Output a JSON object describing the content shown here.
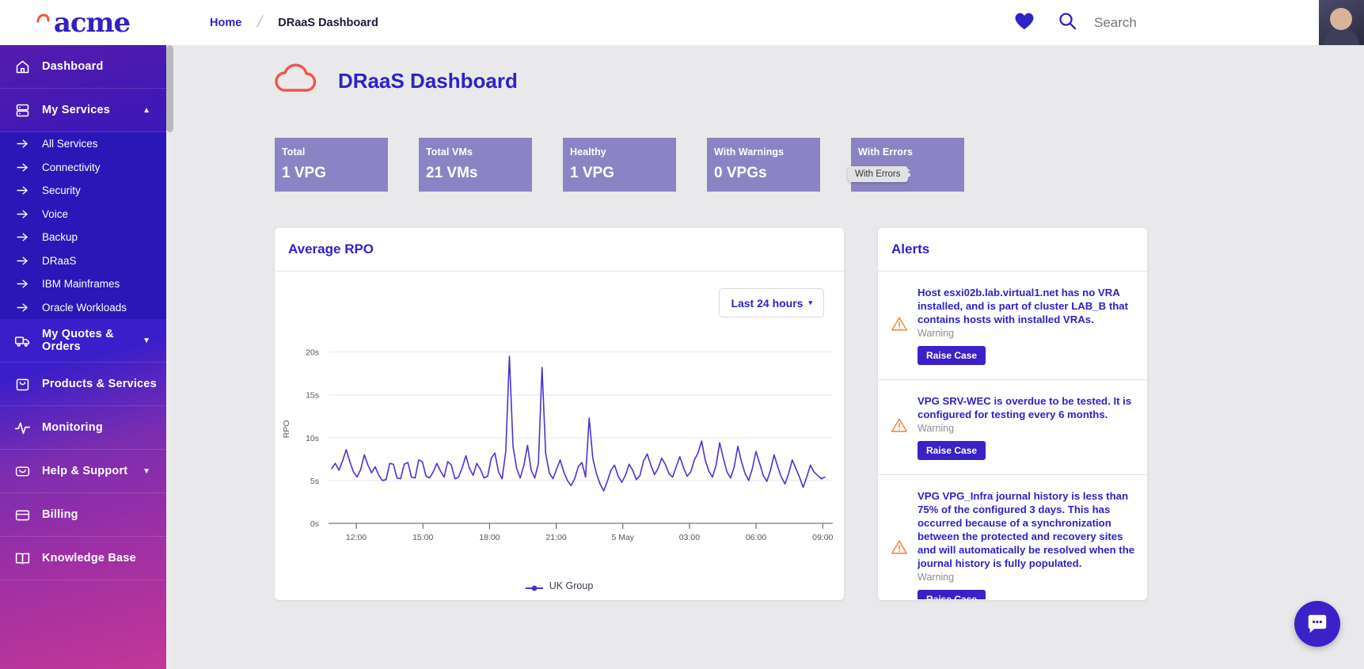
{
  "brand": {
    "name": "acme",
    "logo_icon": "acme-swoosh-icon"
  },
  "topbar": {
    "breadcrumb": {
      "home": "Home",
      "current": "DRaaS Dashboard"
    },
    "favorites_icon": "heart-icon",
    "search": {
      "icon": "search-icon",
      "placeholder": "Search",
      "value": ""
    },
    "avatar_icon": "user-avatar"
  },
  "sidebar": {
    "items": [
      {
        "label": "Dashboard",
        "icon": "home-icon",
        "active": true,
        "caret": ""
      },
      {
        "label": "My Services",
        "icon": "server-icon",
        "active": false,
        "caret": "▲"
      },
      {
        "label": "My Quotes & Orders",
        "icon": "truck-icon",
        "active": false,
        "caret": "▼"
      },
      {
        "label": "Products & Services",
        "icon": "bag-icon",
        "active": false,
        "caret": ""
      },
      {
        "label": "Monitoring",
        "icon": "pulse-icon",
        "active": false,
        "caret": ""
      },
      {
        "label": "Help & Support",
        "icon": "inbox-icon",
        "active": false,
        "caret": "▼"
      },
      {
        "label": "Billing",
        "icon": "card-icon",
        "active": false,
        "caret": ""
      },
      {
        "label": "Knowledge Base",
        "icon": "book-icon",
        "active": false,
        "caret": ""
      }
    ],
    "subitems": [
      {
        "label": "All Services",
        "icon": "arrow-right-icon"
      },
      {
        "label": "Connectivity",
        "icon": "arrow-right-icon"
      },
      {
        "label": "Security",
        "icon": "arrow-right-icon"
      },
      {
        "label": "Voice",
        "icon": "arrow-right-icon"
      },
      {
        "label": "Backup",
        "icon": "arrow-right-icon"
      },
      {
        "label": "DRaaS",
        "icon": "arrow-right-icon"
      },
      {
        "label": "IBM Mainframes",
        "icon": "arrow-right-icon"
      },
      {
        "label": "Oracle Workloads",
        "icon": "arrow-right-icon"
      }
    ]
  },
  "page": {
    "title": "DRaaS Dashboard",
    "icon": "cloud-icon"
  },
  "stats": [
    {
      "label": "Total",
      "value": "1 VPG"
    },
    {
      "label": "Total VMs",
      "value": "21 VMs"
    },
    {
      "label": "Healthy",
      "value": "1 VPG"
    },
    {
      "label": "With Warnings",
      "value": "0 VPGs"
    },
    {
      "label": "With Errors",
      "value": "0 VPGs",
      "tooltip": "With Errors"
    }
  ],
  "chart_panel": {
    "title": "Average RPO",
    "range_button": {
      "label": "Last 24 hours",
      "caret": "▾"
    },
    "legend": {
      "label": "UK Group",
      "color": "#4b32d6"
    }
  },
  "chart_data": {
    "type": "line",
    "title": "Average RPO",
    "xlabel": "",
    "ylabel": "RPO",
    "ylim": [
      0,
      22
    ],
    "yticks": [
      "0s",
      "5s",
      "10s",
      "15s",
      "20s"
    ],
    "ytick_values": [
      0,
      5,
      10,
      15,
      20
    ],
    "xticks": [
      "12:00",
      "15:00",
      "18:00",
      "21:00",
      "5 May",
      "03:00",
      "06:00",
      "09:00"
    ],
    "grid": true,
    "legend_position": "bottom",
    "series": [
      {
        "name": "UK Group",
        "color": "#4b32d6",
        "values": [
          6.4,
          7.0,
          6.2,
          7.3,
          8.6,
          7.2,
          6.0,
          5.4,
          6.3,
          8.0,
          6.8,
          5.9,
          6.6,
          5.6,
          5.0,
          5.1,
          7.0,
          6.9,
          5.3,
          5.2,
          6.9,
          7.1,
          5.4,
          5.3,
          7.4,
          7.2,
          5.5,
          5.3,
          6.0,
          7.0,
          6.1,
          5.4,
          7.2,
          6.8,
          5.2,
          5.4,
          6.5,
          7.9,
          6.4,
          5.6,
          7.0,
          6.3,
          5.3,
          5.5,
          7.6,
          8.2,
          6.0,
          5.2,
          8.4,
          19.5,
          9.0,
          6.4,
          5.3,
          6.8,
          9.1,
          6.2,
          5.3,
          7.0,
          18.2,
          8.2,
          5.9,
          5.2,
          6.3,
          7.4,
          6.0,
          5.0,
          4.4,
          5.2,
          6.6,
          7.1,
          5.4,
          12.3,
          7.6,
          5.8,
          4.6,
          3.8,
          4.9,
          6.2,
          6.8,
          5.5,
          4.8,
          5.6,
          6.9,
          6.2,
          5.1,
          5.6,
          7.3,
          8.1,
          6.8,
          5.7,
          6.4,
          7.6,
          6.9,
          5.8,
          5.4,
          6.6,
          7.8,
          6.5,
          5.5,
          6.0,
          7.4,
          8.2,
          9.6,
          7.4,
          6.1,
          5.4,
          6.8,
          9.4,
          7.6,
          6.0,
          5.3,
          6.6,
          9.0,
          7.2,
          5.8,
          5.0,
          6.4,
          8.4,
          7.0,
          5.6,
          4.9,
          6.2,
          8.0,
          6.6,
          5.4,
          4.6,
          5.8,
          7.4,
          6.4,
          5.4,
          4.2,
          5.4,
          6.8,
          6.0,
          5.6,
          5.2,
          5.4
        ]
      }
    ]
  },
  "alerts_panel": {
    "title": "Alerts",
    "alerts": [
      {
        "message": "Host esxi02b.lab.virtual1.net has no VRA installed, and is part of cluster LAB_B that contains hosts with installed VRAs.",
        "severity": "Warning",
        "action_label": "Raise Case",
        "icon": "warning-triangle-icon"
      },
      {
        "message": "VPG SRV-WEC is overdue to be tested. It is configured for testing every 6 months.",
        "severity": "Warning",
        "action_label": "Raise Case",
        "icon": "warning-triangle-icon"
      },
      {
        "message": "VPG VPG_Infra journal history is less than 75% of the configured 3 days. This has occurred because of a synchronization between the protected and recovery sites and will automatically be resolved when the journal history is fully populated.",
        "severity": "Warning",
        "action_label": "Raise Case",
        "icon": "warning-triangle-icon"
      }
    ]
  },
  "chat": {
    "icon": "chat-bubble-icon"
  },
  "colors": {
    "brand_purple": "#2e22c8",
    "stat_card": "#8b84c4",
    "chart_line": "#4b32d6",
    "warning": "#f08a3c",
    "page_bg": "#e9e9eb"
  }
}
